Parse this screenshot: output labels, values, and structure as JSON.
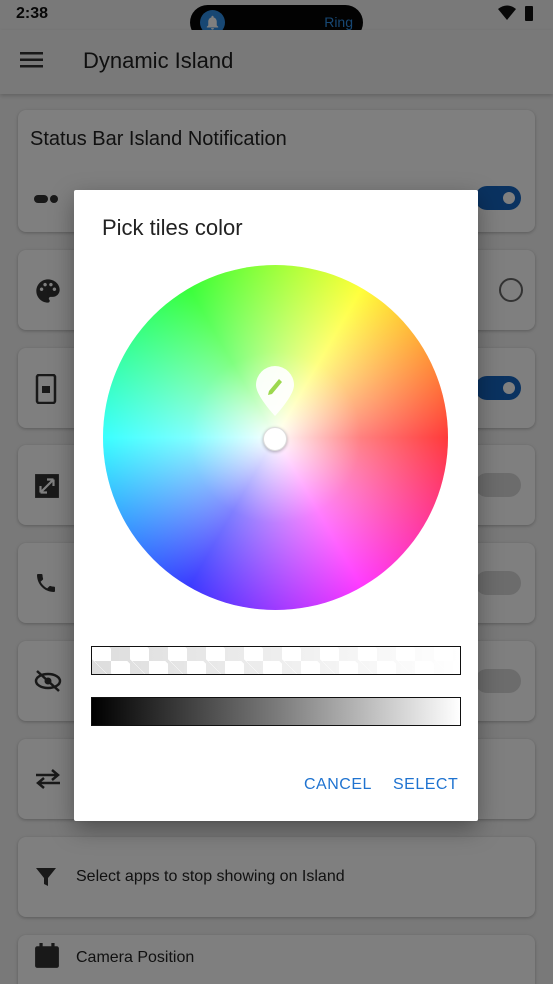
{
  "status_bar": {
    "time": "2:38",
    "island_text": "Ring",
    "icons": [
      "bell-icon",
      "wifi-icon",
      "battery-icon"
    ]
  },
  "app_bar": {
    "title": "Dynamic Island"
  },
  "background": {
    "status_bar_card_title": "Status Bar Island Notification",
    "filter_label": "Select apps to stop showing on Island",
    "camera_label": "Camera Position"
  },
  "dialog": {
    "title": "Pick tiles color",
    "cancel_label": "CANCEL",
    "select_label": "SELECT"
  },
  "colors": {
    "accent": "#1f73d0",
    "switch_on": "#1565c0",
    "island_icon": "#2f8fe6"
  }
}
